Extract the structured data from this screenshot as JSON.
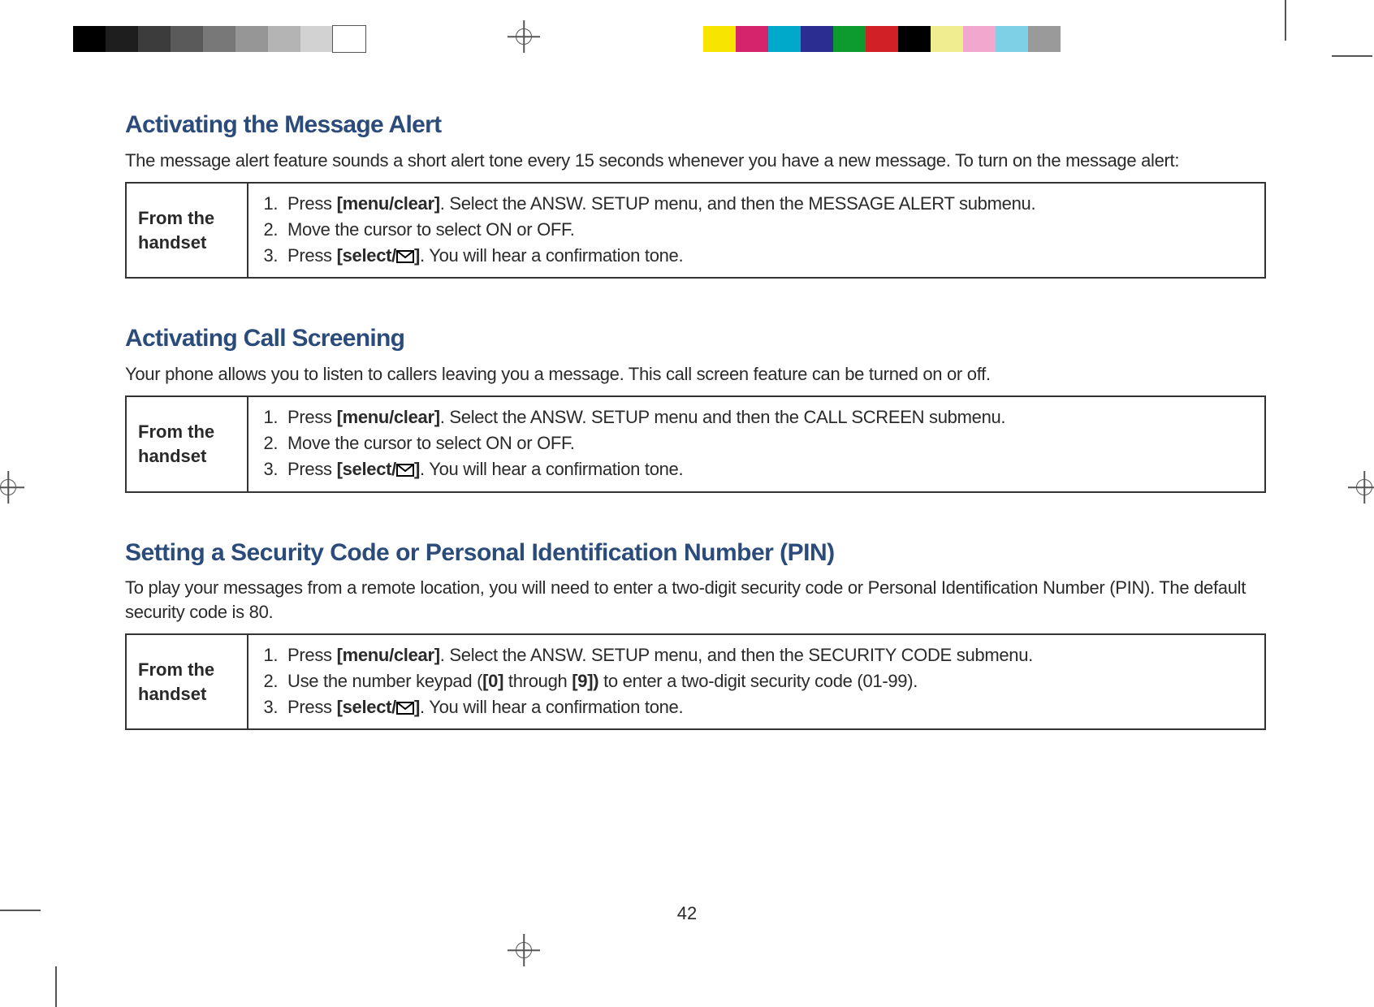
{
  "page_number": "42",
  "sections": [
    {
      "title": "Activating the Message Alert",
      "intro": "The message alert feature sounds a short alert tone every 15 seconds whenever you have a new message. To turn on the message alert:",
      "left_label": "From the handset",
      "steps": [
        {
          "prefix": "Press ",
          "bold1": "[menu/clear]",
          "mid": ". Select the ANSW. SETUP menu, and then the MESSAGE ALERT submenu."
        },
        {
          "plain": "Move the cursor to select ON or OFF."
        },
        {
          "prefix": "Press ",
          "select_label": "[select/",
          "select_suffix": "]",
          "tail": ". You will hear a confirmation tone."
        }
      ]
    },
    {
      "title": "Activating Call Screening",
      "intro": "Your phone allows you to listen to callers leaving you a message. This call screen feature can be turned on or off.",
      "left_label": "From the handset",
      "steps": [
        {
          "prefix": "Press ",
          "bold1": "[menu/clear]",
          "mid": ". Select the ANSW. SETUP menu and then the CALL SCREEN submenu."
        },
        {
          "plain": "Move the cursor to select ON or OFF."
        },
        {
          "prefix": "Press ",
          "select_label": "[select/",
          "select_suffix": "]",
          "tail": ". You will hear a confirmation tone."
        }
      ]
    },
    {
      "title": "Setting a Security Code or Personal Identification Number (PIN)",
      "intro": "To play your messages from a remote location, you will need to enter a two-digit security code or Personal Identification Number (PIN). The default security code is 80.",
      "left_label": "From the handset",
      "steps": [
        {
          "prefix": "Press ",
          "bold1": "[menu/clear]",
          "mid": ". Select the ANSW. SETUP menu, and then the SECURITY CODE submenu."
        },
        {
          "pin_prefix": "Use the number keypad (",
          "pin_b1": "[0]",
          "pin_mid": " through ",
          "pin_b2": "[9])",
          "pin_tail": " to enter a two-digit security code (01-99)."
        },
        {
          "prefix": "Press ",
          "select_label": "[select/",
          "select_suffix": "]",
          "tail": ". You will hear a confirmation tone."
        }
      ]
    }
  ]
}
